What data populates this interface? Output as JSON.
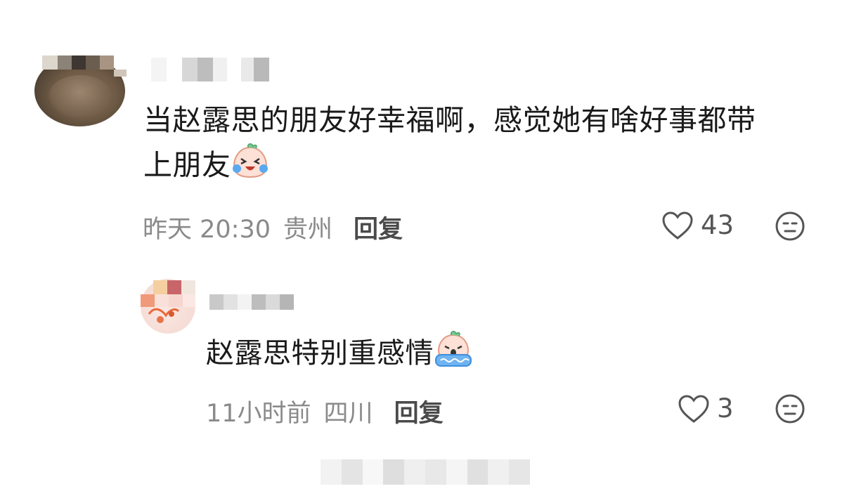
{
  "comments": [
    {
      "text": "当赵露思的朋友好幸福啊，感觉她有啥好事都带上朋友",
      "text_line1": "当赵露思的朋友好幸福啊，感觉她有啥好事都带",
      "text_line2": "上朋友",
      "emoji": "crying-laughing-emoji",
      "time": "昨天 20:30",
      "location": "贵州",
      "reply_label": "回复",
      "likes": "43"
    },
    {
      "text": "赵露思特别重感情",
      "emoji": "crying-flood-emoji",
      "time": "11小时前",
      "location": "四川",
      "reply_label": "回复",
      "likes": "3"
    }
  ],
  "colors": {
    "text": "#1a1a1a",
    "meta": "#8a8a8a",
    "icon": "#555555"
  }
}
